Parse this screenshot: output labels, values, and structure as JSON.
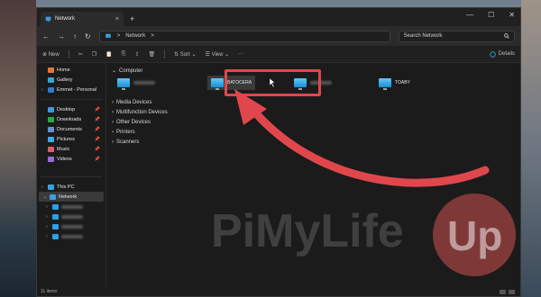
{
  "window": {
    "tab_title": "Network",
    "close_tab": "×",
    "new_tab": "+",
    "controls": {
      "minimize": "—",
      "maximize": "☐",
      "close": "✕"
    }
  },
  "addressbar": {
    "back": "←",
    "forward": "→",
    "up": "↑",
    "refresh": "↻",
    "path_separator": ">",
    "path": "Network",
    "search_placeholder": "Search Network"
  },
  "toolbar": {
    "new_label": "New",
    "sort_label": "Sort",
    "view_label": "View",
    "more_label": "···",
    "details_label": "Details"
  },
  "sidebar": {
    "top": [
      {
        "label": "Home",
        "color": "#e07a3a"
      },
      {
        "label": "Gallery",
        "color": "#3aa0e0"
      },
      {
        "label": "Emmet - Personal",
        "color": "#2e7ad1"
      }
    ],
    "quick": [
      {
        "label": "Desktop",
        "color": "#3a9be0"
      },
      {
        "label": "Downloads",
        "color": "#2ba84a"
      },
      {
        "label": "Documents",
        "color": "#6a8fd8"
      },
      {
        "label": "Pictures",
        "color": "#3fa8e8"
      },
      {
        "label": "Music",
        "color": "#e05a6a"
      },
      {
        "label": "Videos",
        "color": "#9a6ae0"
      }
    ],
    "this_pc": "This PC",
    "network": "Network",
    "pin": "📌"
  },
  "main": {
    "computer_group": "Computer",
    "computers": [
      {
        "name": ""
      },
      {
        "name": "BATOCERA"
      },
      {
        "name": ""
      },
      {
        "name": "TOABY"
      }
    ],
    "groups": [
      "Media Devices",
      "Multifunction Devices",
      "Other Devices",
      "Printers",
      "Scanners"
    ]
  },
  "status": {
    "items": "11 items"
  },
  "watermark": {
    "text": "PiMyLifeUp"
  },
  "colors": {
    "accent_red": "#e0474c",
    "monitor_blue": "#2aa0e8"
  }
}
